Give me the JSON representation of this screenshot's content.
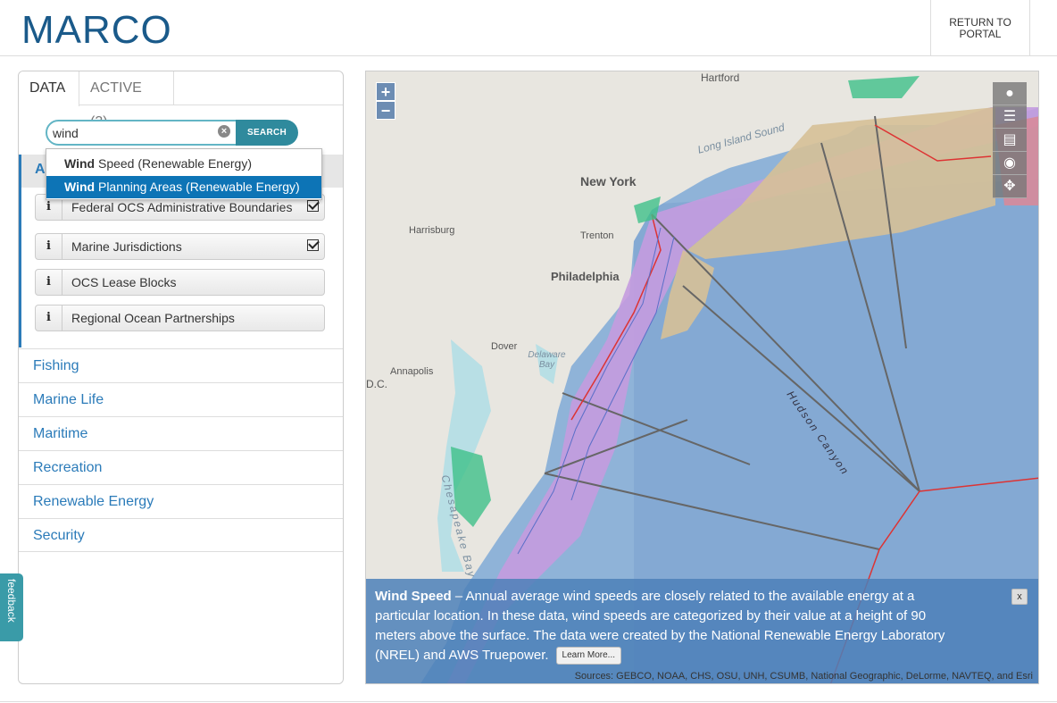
{
  "header": {
    "logo_text": "MARCO",
    "return_label": "RETURN TO PORTAL"
  },
  "tabs": {
    "data": "DATA",
    "active": "ACTIVE (3)"
  },
  "search": {
    "value": "wind",
    "button": "SEARCH",
    "clear": "×",
    "suggestions": [
      {
        "bold": "Wind",
        "rest": " Speed (Renewable Energy)"
      },
      {
        "bold": "Wind",
        "rest": " Planning Areas (Renewable Energy)"
      }
    ]
  },
  "active_section": {
    "title": "A",
    "layers": [
      {
        "label": "Federal OCS Administrative Boundaries",
        "checked": true
      },
      {
        "label": "Marine Jurisdictions",
        "checked": true
      },
      {
        "label": "OCS Lease Blocks",
        "checked": false
      },
      {
        "label": "Regional Ocean Partnerships",
        "checked": false
      }
    ],
    "info_glyph": "i"
  },
  "categories": [
    "Fishing",
    "Marine Life",
    "Maritime",
    "Recreation",
    "Renewable Energy",
    "Security"
  ],
  "feedback": "feedback",
  "map": {
    "zoom_in": "+",
    "zoom_out": "−",
    "labels": {
      "hartford": "Hartford",
      "long_island_sound": "Long Island Sound",
      "new_york": "New York",
      "harrisburg": "Harrisburg",
      "trenton": "Trenton",
      "philadelphia": "Philadelphia",
      "dover": "Dover",
      "delaware_bay": "Delaware Bay",
      "annapolis": "Annapolis",
      "dc": "D.C.",
      "hudson_canyon": "Hudson Canyon",
      "chesapeake_bay": "Chesapeake Bay"
    }
  },
  "info_box": {
    "title": "Wind Speed",
    "body": " – Annual average wind speeds are closely related to the available energy at a particular location. In these data, wind speeds are categorized by their value at a height of 90 meters above the surface. The data were created by the National Renewable Energy Laboratory (NREL) and AWS Truepower.",
    "learn_more": "Learn More...",
    "close": "x",
    "sources": "Sources: GEBCO, NOAA, CHS, OSU, UNH, CSUMB, National Geographic, DeLorme, NAVTEQ, and Esri"
  }
}
